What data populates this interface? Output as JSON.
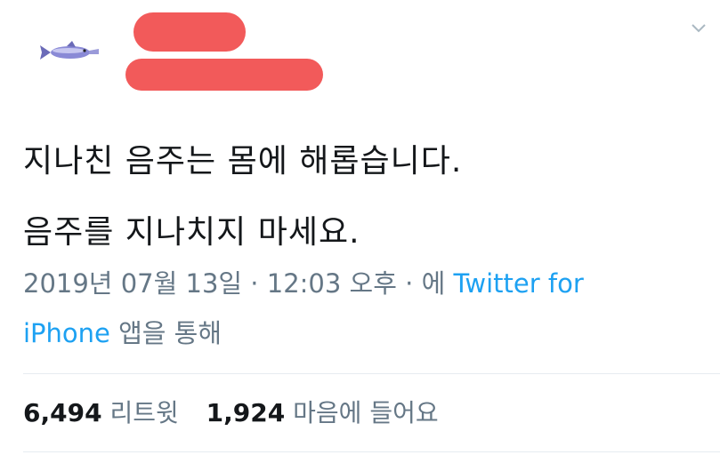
{
  "tweet": {
    "text_lines": [
      "지나친 음주는 몸에 해롭습니다.",
      "음주를 지나치지 마세요."
    ],
    "date": "2019년 07월 13일",
    "separator1": " · ",
    "time": "12:03 오후",
    "separator2": " · ",
    "via_prefix": "에 ",
    "source_part1": "Twitter for",
    "source_part2": "iPhone",
    "via_suffix": " 앱을 통해"
  },
  "stats": {
    "retweets_count": "6,494",
    "retweets_label": "리트윗",
    "likes_count": "1,924",
    "likes_label": "마음에 들어요"
  },
  "icons": {
    "avatar": "fish-avatar",
    "menu": "chevron-down-icon"
  },
  "colors": {
    "link": "#1da1f2",
    "secondary": "#657786",
    "redaction": "#f25a5a"
  }
}
